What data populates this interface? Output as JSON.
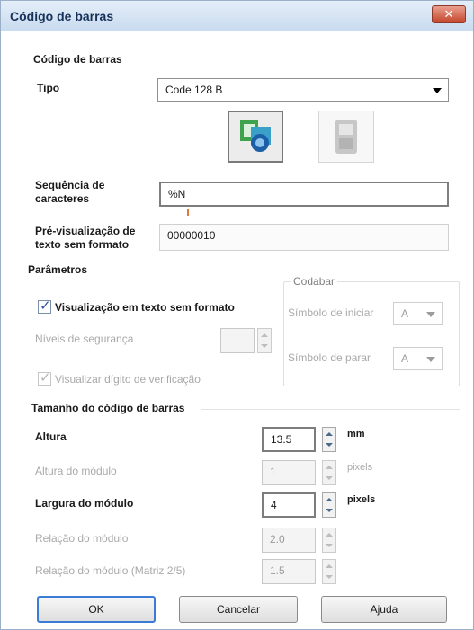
{
  "window": {
    "title": "Código de barras",
    "close": "✕"
  },
  "barcode": {
    "group_title": "Código de barras",
    "type_label": "Tipo",
    "type_value": "Code 128 B",
    "sequence_label_1": "Sequência de",
    "sequence_label_2": "caracteres",
    "sequence_value": "%N",
    "preview_label_1": "Pré-visualização de",
    "preview_label_2": "texto sem formato",
    "preview_value": "00000010"
  },
  "parameters": {
    "group_title": "Parâmetros",
    "show_text_label": "Visualização em texto sem formato",
    "show_text_checked": true,
    "security_label": "Níveis de segurança",
    "security_value": "",
    "check_digit_label": "Visualizar dígito de verificação",
    "check_digit_checked": true
  },
  "codabar": {
    "group_title": "Codabar",
    "start_label": "Símbolo de iniciar",
    "start_value": "A",
    "stop_label": "Símbolo de parar",
    "stop_value": "A"
  },
  "size": {
    "group_title": "Tamanho do código de barras",
    "height_label": "Altura",
    "height_value": "13.5",
    "height_unit": "mm",
    "module_height_label": "Altura do módulo",
    "module_height_value": "1",
    "module_height_unit": "pixels",
    "module_width_label": "Largura do módulo",
    "module_width_value": "4",
    "module_width_unit": "pixels",
    "ratio_label": "Relação do módulo",
    "ratio_value": "2.0",
    "ratio_matrix_label": "Relação do módulo (Matriz 2/5)",
    "ratio_matrix_value": "1.5"
  },
  "buttons": {
    "ok": "OK",
    "cancel": "Cancelar",
    "help": "Ajuda"
  }
}
